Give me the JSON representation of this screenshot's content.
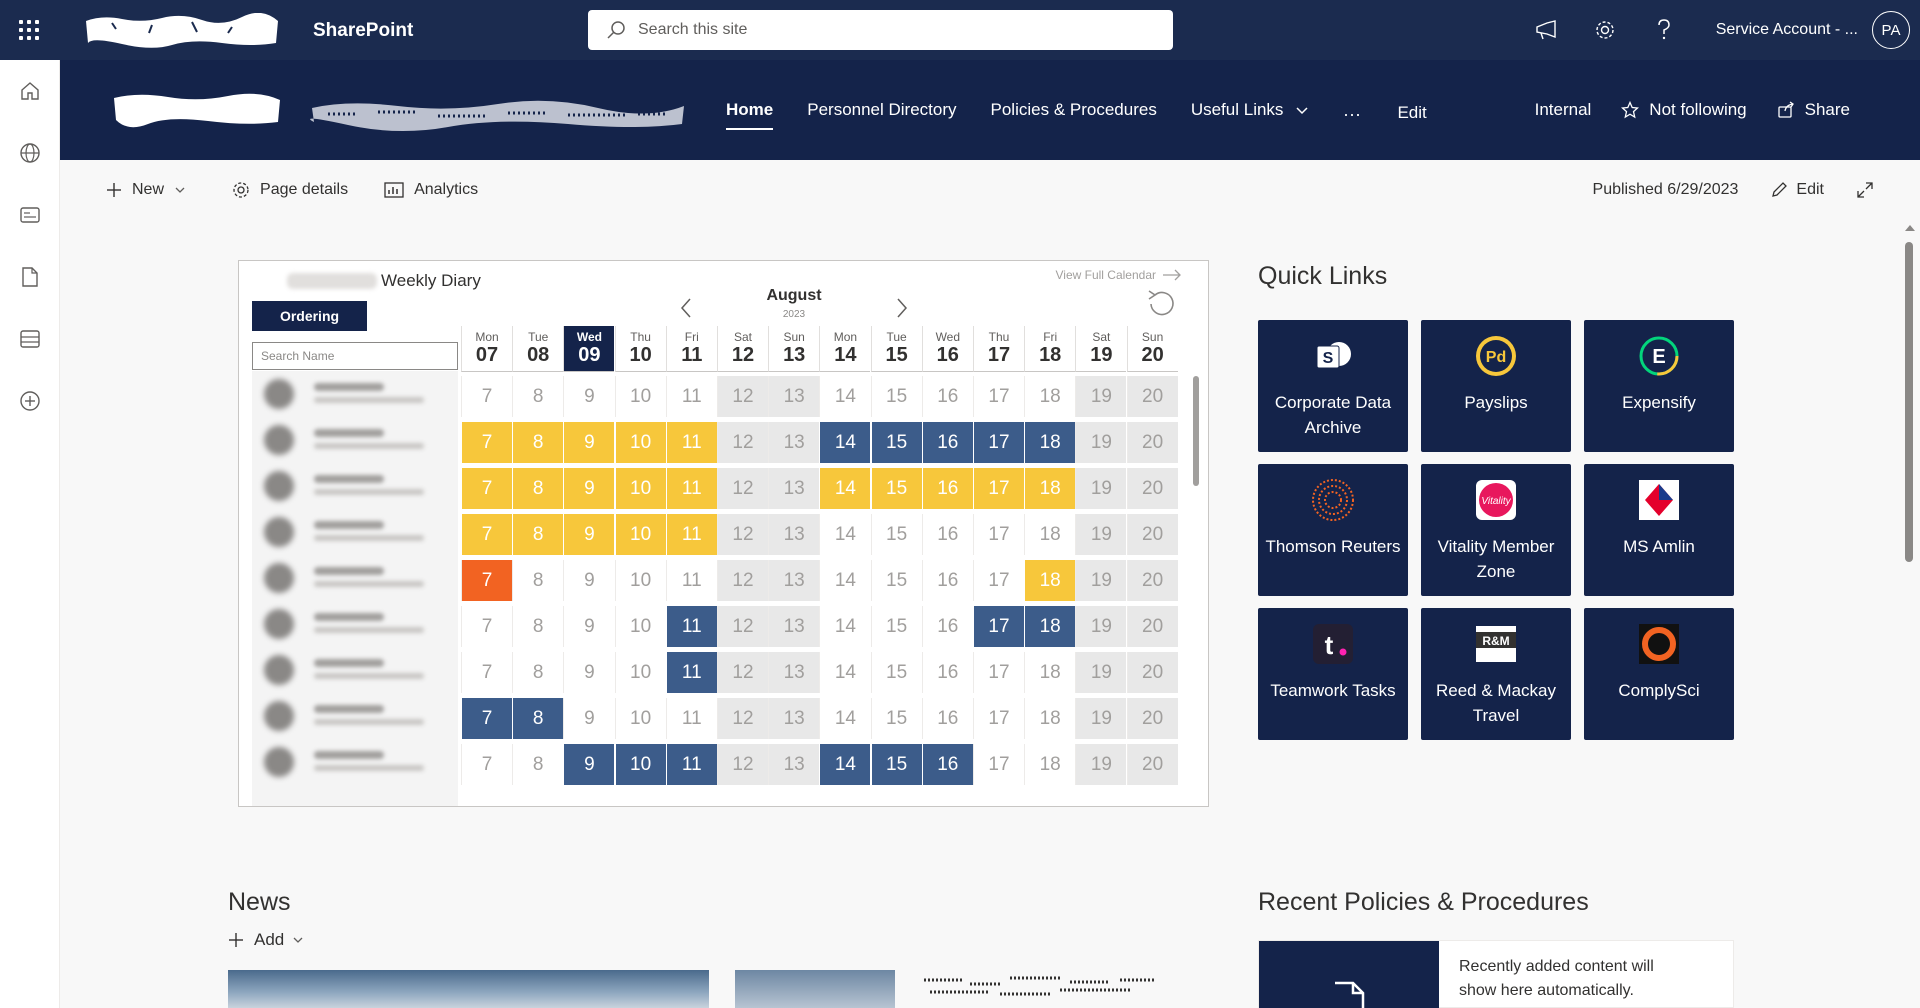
{
  "suitebar": {
    "app_name": "SharePoint",
    "search_placeholder": "Search this site",
    "account_name": "Service Account - ...",
    "avatar_initials": "PA"
  },
  "site": {
    "nav": [
      {
        "label": "Home",
        "active": true
      },
      {
        "label": "Personnel Directory"
      },
      {
        "label": "Policies & Procedures"
      },
      {
        "label": "Useful Links",
        "dropdown": true
      }
    ],
    "nav_more": "...",
    "nav_edit": "Edit",
    "actions": {
      "internal": "Internal",
      "following": "Not following",
      "share": "Share"
    }
  },
  "commandbar": {
    "new": "New",
    "page_details": "Page details",
    "analytics": "Analytics",
    "published": "Published 6/29/2023",
    "edit": "Edit"
  },
  "diary": {
    "title": "Weekly Diary",
    "ordering": "Ordering",
    "view_full": "View Full Calendar",
    "month": "August",
    "year": "2023",
    "search_placeholder": "Search Name",
    "today_index": 2,
    "days": [
      {
        "name": "Mon",
        "num": "07",
        "short": "7"
      },
      {
        "name": "Tue",
        "num": "08",
        "short": "8"
      },
      {
        "name": "Wed",
        "num": "09",
        "short": "9"
      },
      {
        "name": "Thu",
        "num": "10",
        "short": "10"
      },
      {
        "name": "Fri",
        "num": "11",
        "short": "11"
      },
      {
        "name": "Sat",
        "num": "12",
        "short": "12"
      },
      {
        "name": "Sun",
        "num": "13",
        "short": "13"
      },
      {
        "name": "Mon",
        "num": "14",
        "short": "14"
      },
      {
        "name": "Tue",
        "num": "15",
        "short": "15"
      },
      {
        "name": "Wed",
        "num": "16",
        "short": "16"
      },
      {
        "name": "Thu",
        "num": "17",
        "short": "17"
      },
      {
        "name": "Fri",
        "num": "18",
        "short": "18"
      },
      {
        "name": "Sat",
        "num": "19",
        "short": "19"
      },
      {
        "name": "Sun",
        "num": "20",
        "short": "20"
      }
    ],
    "rows": [
      "....._______",
      "yyyyy__bbbbb__",
      "yyyyy__yyyyy__",
      "yyyyy_________",
      "o__________y___",
      "....b_____bb__",
      "....b_________",
      "bb____________",
      "..bbb__bbb____"
    ],
    "colors": {
      "yellow": "#f7c73b",
      "blue": "#3c5c8a",
      "orange": "#f26322",
      "navy": "#14234a"
    }
  },
  "quick_links": {
    "title": "Quick Links",
    "items": [
      {
        "label": "Corporate Data Archive",
        "icon": "sharepoint-icon"
      },
      {
        "label": "Payslips",
        "icon": "payslips-icon"
      },
      {
        "label": "Expensify",
        "icon": "expensify-icon"
      },
      {
        "label": "Thomson Reuters",
        "icon": "thomson-reuters-icon"
      },
      {
        "label": "Vitality Member Zone",
        "icon": "vitality-icon"
      },
      {
        "label": "MS Amlin",
        "icon": "ms-amlin-icon"
      },
      {
        "label": "Teamwork Tasks",
        "icon": "teamwork-icon"
      },
      {
        "label": "Reed & Mackay Travel",
        "icon": "reed-mackay-icon"
      },
      {
        "label": "ComplySci",
        "icon": "complysci-icon"
      }
    ]
  },
  "news": {
    "title": "News",
    "add": "Add"
  },
  "recent_policies": {
    "title": "Recent Policies & Procedures",
    "empty_text": "Recently added content will show here automatically."
  }
}
